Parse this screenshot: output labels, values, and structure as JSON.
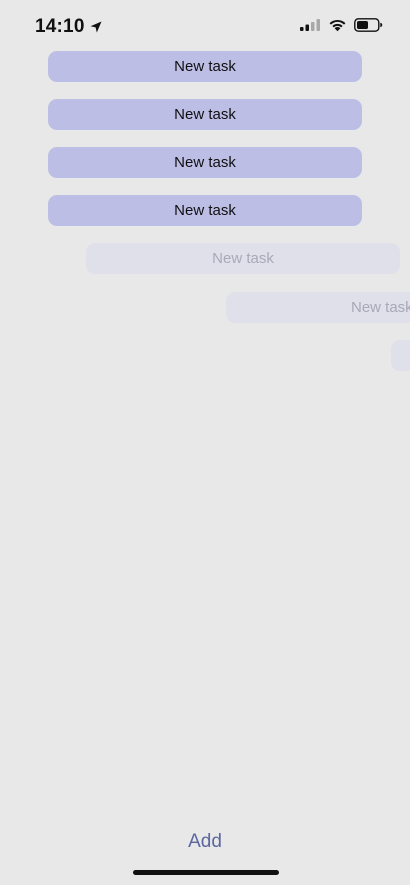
{
  "status_bar": {
    "time": "14:10",
    "icons": [
      "location-arrow-icon",
      "signal-icon",
      "wifi-icon",
      "battery-icon"
    ]
  },
  "tasks": [
    {
      "label": "New task",
      "state": "active"
    },
    {
      "label": "New task",
      "state": "active"
    },
    {
      "label": "New task",
      "state": "active"
    },
    {
      "label": "New task",
      "state": "active"
    },
    {
      "label": "New task",
      "state": "animating"
    },
    {
      "label": "New task",
      "state": "animating"
    },
    {
      "label": "",
      "state": "animating"
    }
  ],
  "footer": {
    "add_label": "Add"
  },
  "colors": {
    "background": "#e8e8e8",
    "task_fill": "#bcbee6",
    "ghost_fill": "#e0e0ea",
    "ghost_text": "#a8a8b8",
    "accent": "#5c66a0"
  }
}
